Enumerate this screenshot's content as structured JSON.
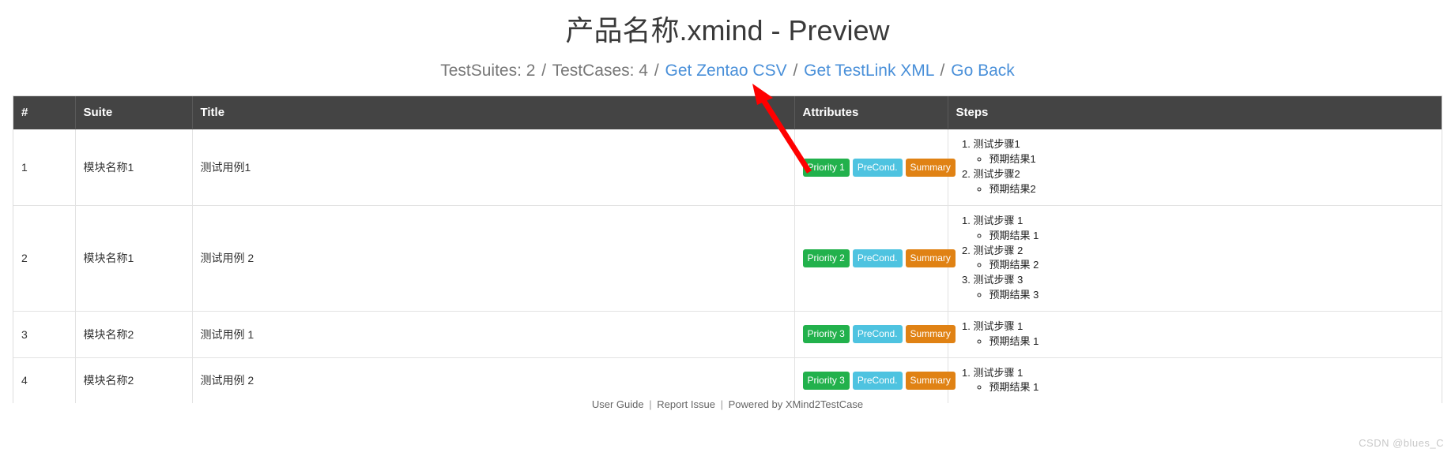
{
  "header": {
    "title": "产品名称.xmind - Preview",
    "summary": {
      "suites_label": "TestSuites: 2",
      "cases_label": "TestCases: 4",
      "separator": "/",
      "links": [
        {
          "label": "Get Zentao CSV"
        },
        {
          "label": "Get TestLink XML"
        },
        {
          "label": "Go Back"
        }
      ]
    }
  },
  "table": {
    "columns": [
      "#",
      "Suite",
      "Title",
      "Attributes",
      "Steps"
    ],
    "rows": [
      {
        "index": "1",
        "suite": "模块名称1",
        "title": "测试用例1",
        "badges": [
          {
            "label": "Priority 1",
            "color": "#22b14c"
          },
          {
            "label": "PreCond.",
            "color": "#4ec3e0"
          },
          {
            "label": "Summary",
            "color": "#e08214"
          }
        ],
        "steps": [
          {
            "action": "测试步骤1",
            "expected": "预期结果1"
          },
          {
            "action": "测试步骤2",
            "expected": "预期结果2"
          }
        ]
      },
      {
        "index": "2",
        "suite": "模块名称1",
        "title": "测试用例 2",
        "badges": [
          {
            "label": "Priority 2",
            "color": "#22b14c"
          },
          {
            "label": "PreCond.",
            "color": "#4ec3e0"
          },
          {
            "label": "Summary",
            "color": "#e08214"
          }
        ],
        "steps": [
          {
            "action": "测试步骤 1",
            "expected": "预期结果 1"
          },
          {
            "action": "测试步骤 2",
            "expected": "预期结果 2"
          },
          {
            "action": "测试步骤 3",
            "expected": "预期结果 3"
          }
        ]
      },
      {
        "index": "3",
        "suite": "模块名称2",
        "title": "测试用例 1",
        "badges": [
          {
            "label": "Priority 3",
            "color": "#22b14c"
          },
          {
            "label": "PreCond.",
            "color": "#4ec3e0"
          },
          {
            "label": "Summary",
            "color": "#e08214"
          }
        ],
        "steps": [
          {
            "action": "测试步骤 1",
            "expected": "预期结果 1"
          }
        ]
      },
      {
        "index": "4",
        "suite": "模块名称2",
        "title": "测试用例 2",
        "badges": [
          {
            "label": "Priority 3",
            "color": "#22b14c"
          },
          {
            "label": "PreCond.",
            "color": "#4ec3e0"
          },
          {
            "label": "Summary",
            "color": "#e08214"
          }
        ],
        "steps": [
          {
            "action": "测试步骤 1",
            "expected": "预期结果 1"
          }
        ]
      }
    ]
  },
  "footer": {
    "links": [
      {
        "label": "User Guide"
      },
      {
        "label": "Report Issue"
      },
      {
        "label": "Powered by XMind2TestCase"
      }
    ],
    "separator": "|"
  },
  "annotation": {
    "arrow_color": "#ff0000",
    "arrow_points_to": "Get Zentao CSV"
  },
  "watermark": {
    "text": "CSDN @blues_C"
  }
}
